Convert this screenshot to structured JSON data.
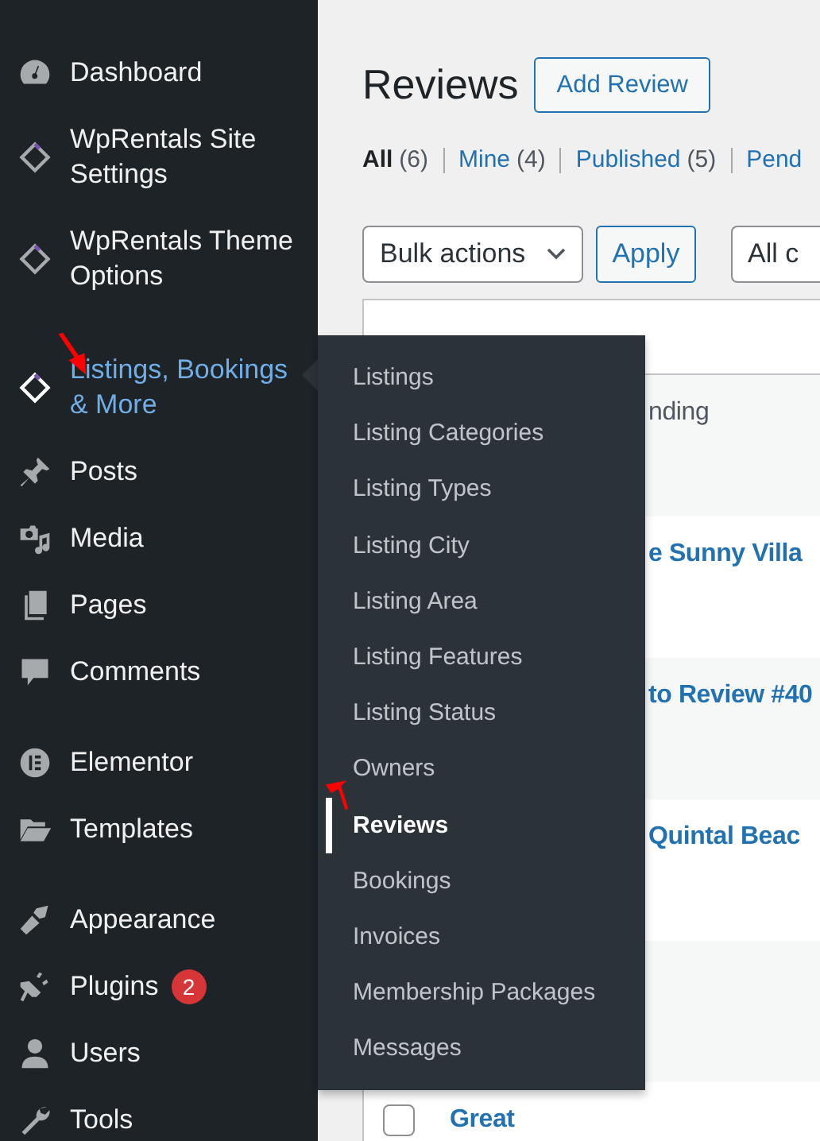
{
  "sidebar": {
    "groups": [
      {
        "items": [
          {
            "label": "Dashboard",
            "selected": false
          },
          {
            "label": "WpRentals Site Settings",
            "selected": false
          },
          {
            "label": "WpRentals Theme Options",
            "selected": false
          }
        ]
      },
      {
        "items": [
          {
            "label": "Listings, Bookings & More",
            "selected": true
          },
          {
            "label": "Posts",
            "selected": false
          },
          {
            "label": "Media",
            "selected": false
          },
          {
            "label": "Pages",
            "selected": false
          },
          {
            "label": "Comments",
            "selected": false
          }
        ]
      },
      {
        "items": [
          {
            "label": "Elementor",
            "selected": false
          },
          {
            "label": "Templates",
            "selected": false
          }
        ]
      },
      {
        "items": [
          {
            "label": "Appearance",
            "selected": false
          },
          {
            "label": "Plugins",
            "selected": false,
            "badge": "2"
          },
          {
            "label": "Users",
            "selected": false
          },
          {
            "label": "Tools",
            "selected": false
          }
        ]
      }
    ]
  },
  "flyout": {
    "items": [
      {
        "label": "Listings",
        "selected": false
      },
      {
        "label": "Listing Categories",
        "selected": false
      },
      {
        "label": "Listing Types",
        "selected": false
      },
      {
        "label": "Listing City",
        "selected": false
      },
      {
        "label": "Listing Area",
        "selected": false
      },
      {
        "label": "Listing Features",
        "selected": false
      },
      {
        "label": "Listing Status",
        "selected": false
      },
      {
        "label": "Owners",
        "selected": false
      },
      {
        "label": "Reviews",
        "selected": true
      },
      {
        "label": "Bookings",
        "selected": false
      },
      {
        "label": "Invoices",
        "selected": false
      },
      {
        "label": "Membership Packages",
        "selected": false
      },
      {
        "label": "Messages",
        "selected": false
      }
    ]
  },
  "page": {
    "title": "Reviews",
    "add_button": "Add Review"
  },
  "filters": [
    {
      "label": "All",
      "count": "(6)",
      "selected": true
    },
    {
      "label": "Mine",
      "count": "(4)",
      "selected": false
    },
    {
      "label": "Published",
      "count": "(5)",
      "selected": false
    },
    {
      "label": "Pend",
      "selected": false
    }
  ],
  "toolbar": {
    "bulk_actions": "Bulk actions",
    "apply": "Apply",
    "filter_select": "All c"
  },
  "table": {
    "rows": [
      {
        "title": "nding",
        "kind": "text"
      },
      {
        "title": "e Sunny Villa",
        "kind": "link"
      },
      {
        "title": "to Review #40",
        "kind": "link"
      },
      {
        "title": "Quintal Beac",
        "kind": "link"
      },
      {
        "kind": "empty"
      },
      {
        "title": "Great",
        "kind": "link",
        "checked": false
      }
    ]
  }
}
